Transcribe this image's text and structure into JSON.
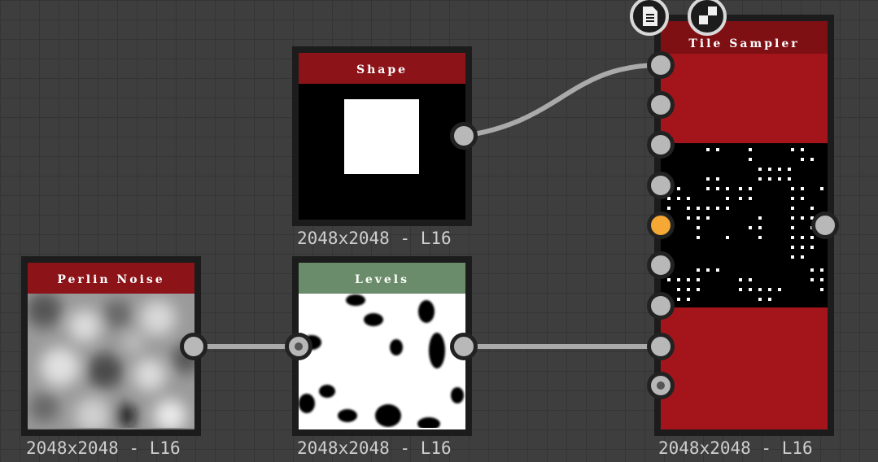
{
  "nodes": {
    "shape": {
      "title": "Shape",
      "resolution": "2048x2048 - L16",
      "header_color": "#8c1419"
    },
    "perlin": {
      "title": "Perlin Noise",
      "resolution": "2048x2048 - L16",
      "header_color": "#8c1419"
    },
    "levels": {
      "title": "Levels",
      "resolution": "2048x2048 - L16",
      "header_color": "#6a8c6a"
    },
    "tile_sampler": {
      "title": "Tile Sampler",
      "resolution": "2048x2048 - L16",
      "header_color": "#a3151a"
    }
  },
  "toolbar": {
    "icons": [
      "document-icon",
      "checker-icon"
    ]
  }
}
